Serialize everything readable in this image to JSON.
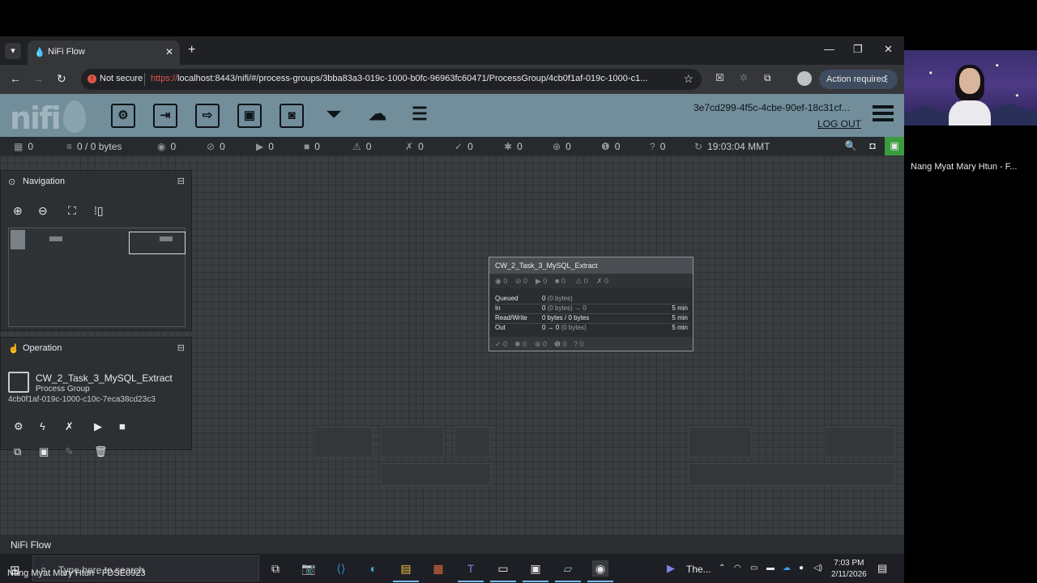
{
  "browser": {
    "tab_title": "NiFi Flow",
    "not_secure": "Not secure",
    "url_scheme": "https://",
    "url_rest": "localhost:8443/nifi/#/process-groups/3bba83a3-019c-1000-b0fc-96963fc60471/ProcessGroup/4cb0f1af-019c-1000-c1...",
    "action_required": "Action required"
  },
  "nifi": {
    "logo": "nifi",
    "user": "3e7cd299-4f5c-4cbe-90ef-18c31cf...",
    "logout": "LOG OUT",
    "status": {
      "threads": "0",
      "queued": "0 / 0 bytes",
      "transmitting": "0",
      "not_transmitting": "0",
      "running": "0",
      "stopped": "0",
      "invalid": "0",
      "disabled": "0",
      "up_to_date": "0",
      "locally_modified": "0",
      "stale": "0",
      "locally_modified_stale": "0",
      "sync_failure": "0",
      "refreshed": "19:03:04 MMT"
    },
    "navigation": {
      "title": "Navigation"
    },
    "operation": {
      "title": "Operation",
      "component_name": "CW_2_Task_3_MySQL_Extract",
      "component_type": "Process Group",
      "component_id": "4cb0f1af-019c-1000-c10c-7eca38cd23c3"
    },
    "process_group": {
      "name": "CW_2_Task_3_MySQL_Extract",
      "counts": [
        "0",
        "0",
        "0",
        "0",
        "0",
        "0"
      ],
      "rows": [
        {
          "label": "Queued",
          "value": "0",
          "sub": "(0 bytes)",
          "right": ""
        },
        {
          "label": "In",
          "value": "0",
          "sub": "(0 bytes) → 0",
          "right": "5 min"
        },
        {
          "label": "Read/Write",
          "value": "0 bytes / 0 bytes",
          "sub": "",
          "right": "5 min"
        },
        {
          "label": "Out",
          "value": "0 → 0",
          "sub": "(0 bytes)",
          "right": "5 min"
        }
      ],
      "footer": [
        "0",
        "0",
        "0",
        "0",
        "0"
      ]
    },
    "breadcrumb": "NiFi Flow"
  },
  "taskbar": {
    "search_placeholder": "Type here to search",
    "meet_label": "The...",
    "time": "7:03 PM",
    "date": "2/11/2026"
  },
  "meeting": {
    "participant_video_label": "Nang Myat Mary Htun - F...",
    "participant_name": "Nang Myat Mary Htun - FDSE0923"
  },
  "colors": {
    "nifi_header": "#728e9b",
    "canvas": "#3a3d40",
    "accent": "#76b9ed"
  }
}
